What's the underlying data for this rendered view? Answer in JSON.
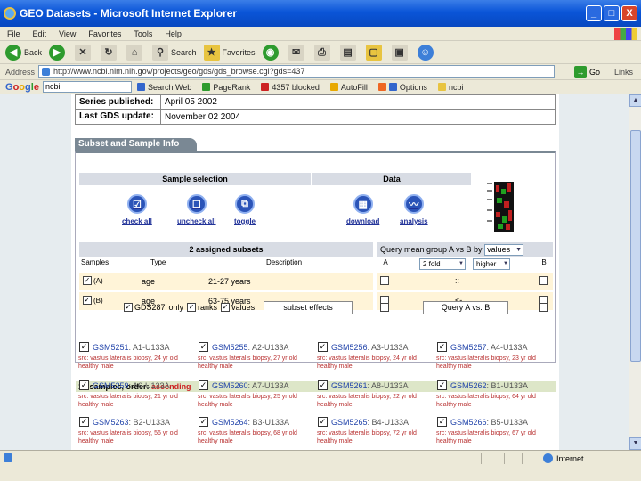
{
  "window": {
    "title": "GEO Datasets - Microsoft Internet Explorer",
    "minimize": "_",
    "maximize": "□",
    "close": "X"
  },
  "menu": [
    "File",
    "Edit",
    "View",
    "Favorites",
    "Tools",
    "Help"
  ],
  "toolbar": {
    "back": "Back",
    "search": "Search",
    "favorites": "Favorites"
  },
  "address": {
    "label": "Address",
    "url": "http://www.ncbi.nlm.nih.gov/projects/geo/gds/gds_browse.cgi?gds=437",
    "go": "Go",
    "links": "Links"
  },
  "googlebar": {
    "logo": [
      "G",
      "o",
      "o",
      "g",
      "l",
      "e"
    ],
    "query": "ncbi",
    "search_web": "Search Web",
    "pagerank": "PageRank",
    "blocked": "4357 blocked",
    "autofill": "AutoFill",
    "options": "Options",
    "ncbi": "ncbi"
  },
  "info": {
    "series_published_label": "Series published:",
    "series_published_value": "April 05 2002",
    "last_update_label": "Last GDS update:",
    "last_update_value": "November 02 2004"
  },
  "subset": {
    "tab_label": "Subset and Sample Info",
    "sample_selection": "Sample selection",
    "data": "Data",
    "tools": {
      "check_all": "check all",
      "uncheck_all": "uncheck all",
      "toggle": "toggle",
      "download": "download",
      "analysis": "analysis"
    },
    "assigned_subsets": "2 assigned subsets",
    "col_samples": "Samples",
    "col_type": "Type",
    "col_description": "Description",
    "rows": [
      {
        "id": "(A)",
        "type": "age",
        "desc": "21-27 years"
      },
      {
        "id": "(B)",
        "type": "age",
        "desc": "63-75 years"
      }
    ],
    "query_label": "Query mean group A vs B by",
    "query_by": "values",
    "col_a": "A",
    "col_b": "B",
    "cmp_fold": "2 fold",
    "cmp_dir": "higher",
    "cmp_rows": [
      "::",
      "<-"
    ],
    "gds_label": "GDS287",
    "only": "only",
    "ranks": "ranks",
    "values": "values",
    "subset_effects": "subset effects",
    "query_btn": "Query A vs. B"
  },
  "samples": {
    "header_prefix": "15 samples, order: ",
    "header_order": "ascending",
    "items": [
      {
        "acc": "GSM5251",
        "lab": ": A1-U133A",
        "src": "src: vastus lateralis biopsy, 24 yr old healthy male"
      },
      {
        "acc": "GSM5255",
        "lab": ": A2-U133A",
        "src": "src: vastus lateralis biopsy, 27 yr old healthy male"
      },
      {
        "acc": "GSM5256",
        "lab": ": A3-U133A",
        "src": "src: vastus lateralis biopsy, 24 yr old healthy male"
      },
      {
        "acc": "GSM5257",
        "lab": ": A4-U133A",
        "src": "src: vastus lateralis biopsy, 23 yr old healthy male"
      },
      {
        "acc": "GSM5259",
        "lab": ": A6-U133A",
        "src": "src: vastus lateralis biopsy, 21 yr old healthy male"
      },
      {
        "acc": "GSM5260",
        "lab": ": A7-U133A",
        "src": "src: vastus lateralis biopsy, 25 yr old healthy male"
      },
      {
        "acc": "GSM5261",
        "lab": ": A8-U133A",
        "src": "src: vastus lateralis biopsy, 22 yr old healthy male"
      },
      {
        "acc": "GSM5262",
        "lab": ": B1-U133A",
        "src": "src: vastus lateralis biopsy, 64 yr old healthy male"
      },
      {
        "acc": "GSM5263",
        "lab": ": B2-U133A",
        "src": "src: vastus lateralis biopsy, 56 yr old healthy male"
      },
      {
        "acc": "GSM5264",
        "lab": ": B3-U133A",
        "src": "src: vastus lateralis biopsy, 68 yr old healthy male"
      },
      {
        "acc": "GSM5265",
        "lab": ": B4-U133A",
        "src": "src: vastus lateralis biopsy, 72 yr old healthy male"
      },
      {
        "acc": "GSM5266",
        "lab": ": B5-U133A",
        "src": "src: vastus lateralis biopsy, 67 yr old healthy male"
      }
    ]
  },
  "status": {
    "zone": "Internet"
  },
  "colors": {
    "titlebar": "#0a55d8",
    "accession_link": "#2244aa",
    "source_text": "#b83030",
    "order_highlight": "#cc2222",
    "section_header": "#7a8894",
    "row_highlight": "#fff4d8"
  }
}
